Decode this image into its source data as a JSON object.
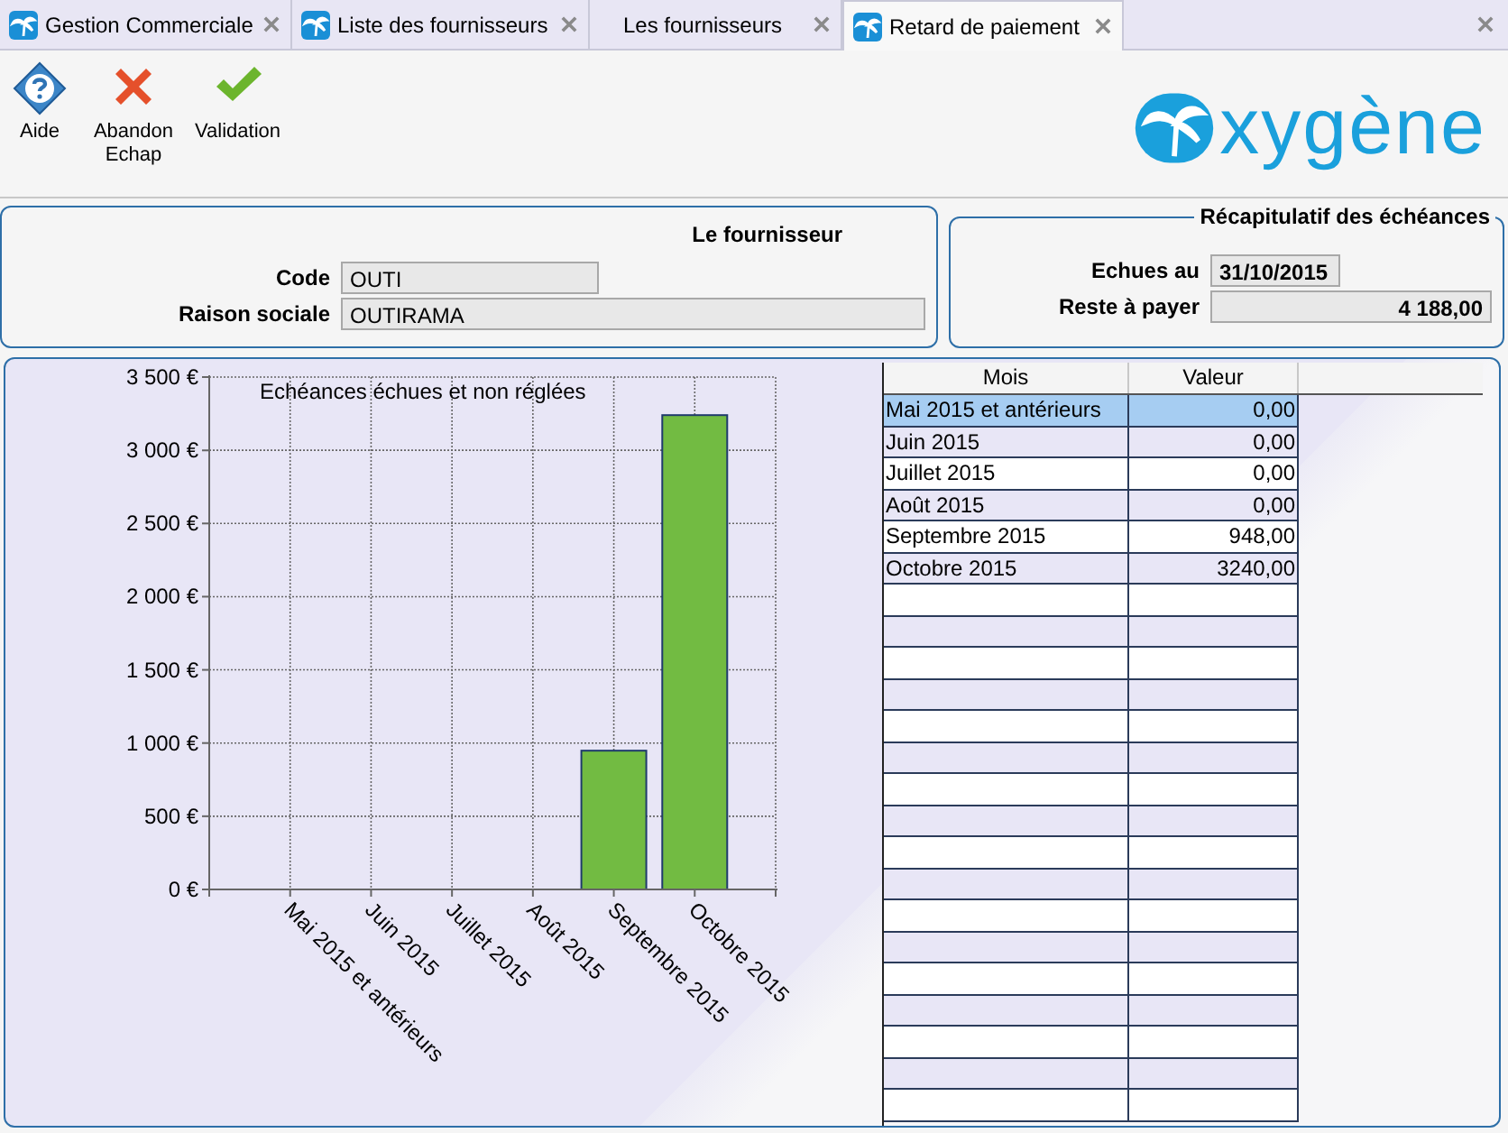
{
  "tabs": [
    {
      "label": "Gestion Commerciale",
      "icon": true,
      "selected": false
    },
    {
      "label": "Liste des fournisseurs",
      "icon": true,
      "selected": false
    },
    {
      "label": "Les fournisseurs",
      "icon": false,
      "selected": false
    },
    {
      "label": "Retard de paiement",
      "icon": true,
      "selected": true
    }
  ],
  "toolbar": [
    {
      "kind": "help",
      "label": "Aide"
    },
    {
      "kind": "cancel",
      "label": "Abandon\nEchap"
    },
    {
      "kind": "validate",
      "label": "Validation"
    }
  ],
  "logo": {
    "text": "xygène"
  },
  "supplier": {
    "title": "Le fournisseur",
    "fields": [
      {
        "label": "Code",
        "value": "OUTI",
        "wide": false
      },
      {
        "label": "Raison sociale",
        "value": "OUTIRAMA",
        "wide": true
      }
    ]
  },
  "summary": {
    "title": "Récapitulatif des échéances",
    "fields": [
      {
        "label": "Echues au",
        "value": "31/10/2015",
        "wide": false
      },
      {
        "label": "Reste à payer",
        "value": "4 188,00",
        "wide": true
      }
    ]
  },
  "chart_data": {
    "type": "bar",
    "title": "Echéances échues et non réglées",
    "categories": [
      "Mai 2015 et antérieurs",
      "Juin 2015",
      "Juillet 2015",
      "Août 2015",
      "Septembre 2015",
      "Octobre 2015"
    ],
    "series": [
      {
        "color": "#72bb42",
        "values": [
          0,
          0,
          0,
          0,
          948,
          3240
        ]
      }
    ],
    "grid": true,
    "ylim": [
      0,
      3500
    ],
    "yticks": [
      {
        "value": 0,
        "label": "0 €"
      },
      {
        "value": 500,
        "label": "500 €"
      },
      {
        "value": 1000,
        "label": "1 000 €"
      },
      {
        "value": 1500,
        "label": "1 500 €"
      },
      {
        "value": 2000,
        "label": "2 000 €"
      },
      {
        "value": 2500,
        "label": "2 500 €"
      },
      {
        "value": 3000,
        "label": "3 000 €"
      },
      {
        "value": 3500,
        "label": "3 500 €"
      }
    ]
  },
  "table": {
    "columns": [
      "Mois",
      "Valeur"
    ],
    "rows": [
      {
        "cells": [
          "Mai 2015 et antérieurs",
          "0,00"
        ],
        "selected": true
      },
      {
        "cells": [
          "Juin 2015",
          "0,00"
        ],
        "selected": false
      },
      {
        "cells": [
          "Juillet 2015",
          "0,00"
        ],
        "selected": false
      },
      {
        "cells": [
          "Août 2015",
          "0,00"
        ],
        "selected": false
      },
      {
        "cells": [
          "Septembre 2015",
          "948,00"
        ],
        "selected": false
      },
      {
        "cells": [
          "Octobre 2015",
          "3240,00"
        ],
        "selected": false
      }
    ]
  }
}
